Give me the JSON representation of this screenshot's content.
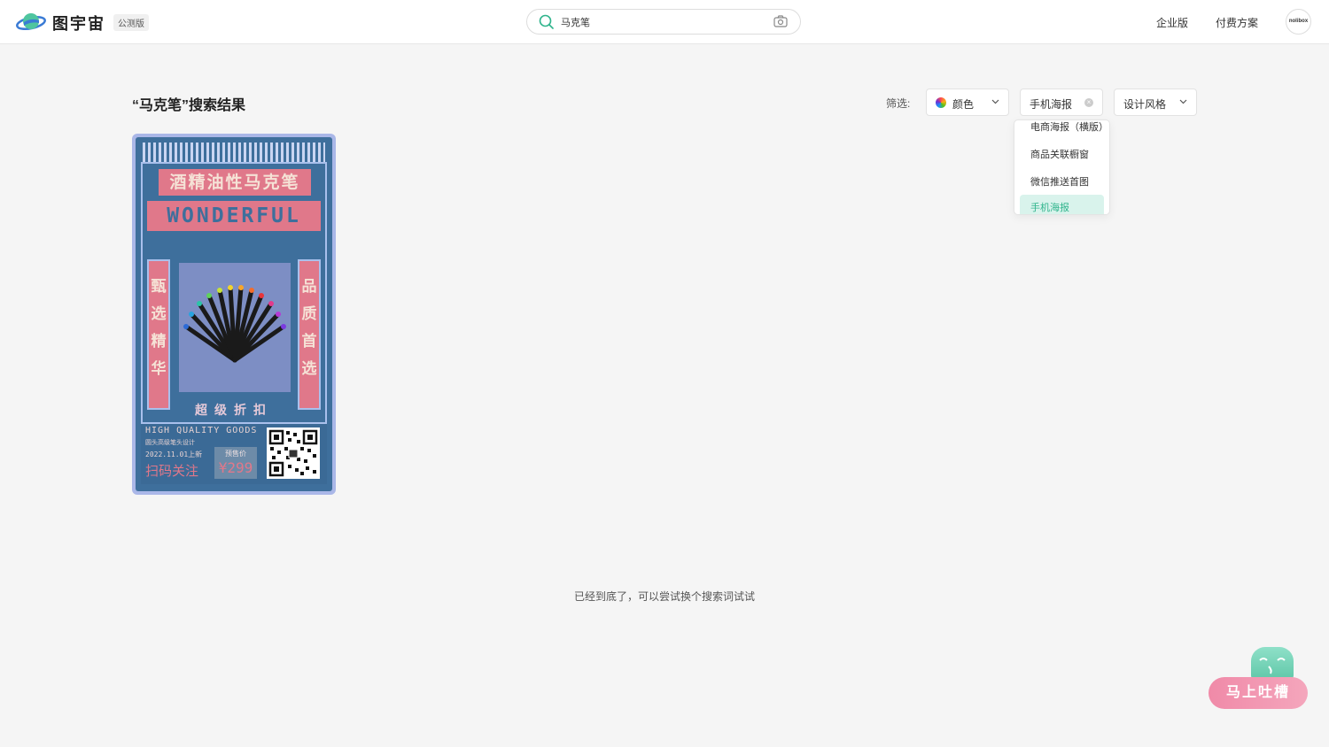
{
  "header": {
    "brand": "图宇宙",
    "beta_badge": "公测版",
    "search_value": "马克笔",
    "nav": [
      "企业版",
      "付费方案"
    ],
    "avatar_text": "nolibox"
  },
  "results": {
    "title": "“马克笔”搜索结果",
    "filter_label": "筛选:",
    "filters": {
      "color": "颜色",
      "scene": "手机海报",
      "style": "设计风格"
    },
    "dropdown": {
      "options": [
        "电商海报（横版）",
        "商品关联橱窗",
        "微信推送首图",
        "手机海报"
      ],
      "selected": "手机海报"
    }
  },
  "poster": {
    "title_cn": "酒精油性马克笔",
    "title_en": "WONDERFUL",
    "left_vertical": "甄选精华",
    "right_vertical": "品质首选",
    "discount": "超级折扣",
    "hq": "HIGH QUALITY GOODS",
    "sub": "圆头高级笔头设计",
    "date": "2022.11.01上新",
    "price_label": "预售价",
    "price": "¥299",
    "scan": "扫码关注"
  },
  "footer": {
    "end_message": "已经到底了，可以尝试换个搜索词试试",
    "feedback_label": "马上吐槽"
  },
  "colors": {
    "accent": "#2fb48c",
    "poster_blue": "#3e6f9c",
    "poster_pink": "#e0788a",
    "feedback_pink": "#f08aa8"
  }
}
